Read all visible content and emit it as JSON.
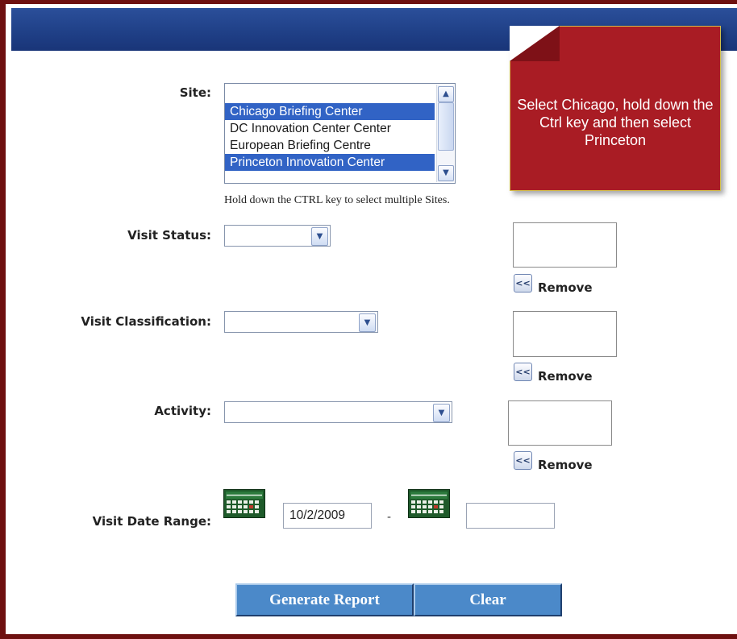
{
  "form": {
    "site": {
      "label": "Site:",
      "options": [
        {
          "text": "",
          "selected": false
        },
        {
          "text": "Chicago Briefing Center",
          "selected": true
        },
        {
          "text": "DC Innovation Center Center",
          "selected": false
        },
        {
          "text": "European Briefing Centre",
          "selected": false
        },
        {
          "text": "Princeton Innovation Center",
          "selected": true
        }
      ],
      "hint": "Hold down the CTRL key to select multiple Sites."
    },
    "visit_status": {
      "label": "Visit Status:",
      "remove_label": "Remove",
      "remove_button": "<<"
    },
    "visit_classification": {
      "label": "Visit Classification:",
      "remove_label": "Remove",
      "remove_button": "<<"
    },
    "activity": {
      "label": "Activity:",
      "remove_label": "Remove",
      "remove_button": "<<"
    },
    "date_range": {
      "label": "Visit Date Range:",
      "start_value": "10/2/2009",
      "separator": "-",
      "end_value": ""
    },
    "actions": {
      "generate_label": "Generate Report",
      "clear_label": "Clear"
    }
  },
  "callout": {
    "text": "Select Chicago, hold down the Ctrl key and then select Princeton"
  },
  "icons": {
    "scroll_up": "chevron-up-icon",
    "scroll_down": "chevron-down-icon",
    "dropdown": "chevron-down-icon",
    "calendar": "calendar-icon"
  },
  "colors": {
    "frame": "#6e1010",
    "header": "#1f3f86",
    "selection": "#3163c5",
    "action_button": "#4b89c9",
    "callout": "#a91c24"
  }
}
